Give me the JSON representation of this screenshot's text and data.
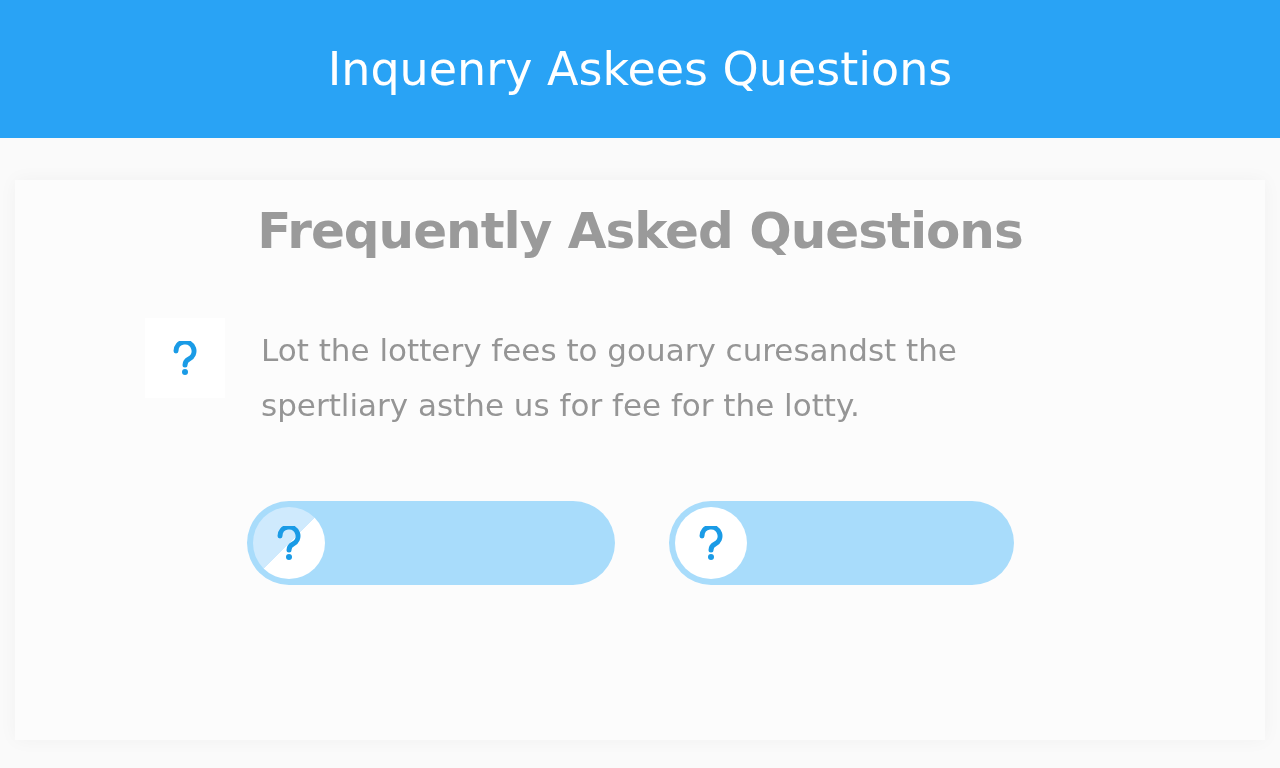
{
  "header": {
    "title": "Inquenry Askees Questions"
  },
  "faq": {
    "heading": "Frequently Asked Questions",
    "question": {
      "text": "Lot the lottery fees to gouary curesandst the spertliary asthe us for fee for the lotty."
    },
    "pills": [
      {
        "kind": "half"
      },
      {
        "kind": "full"
      }
    ]
  }
}
